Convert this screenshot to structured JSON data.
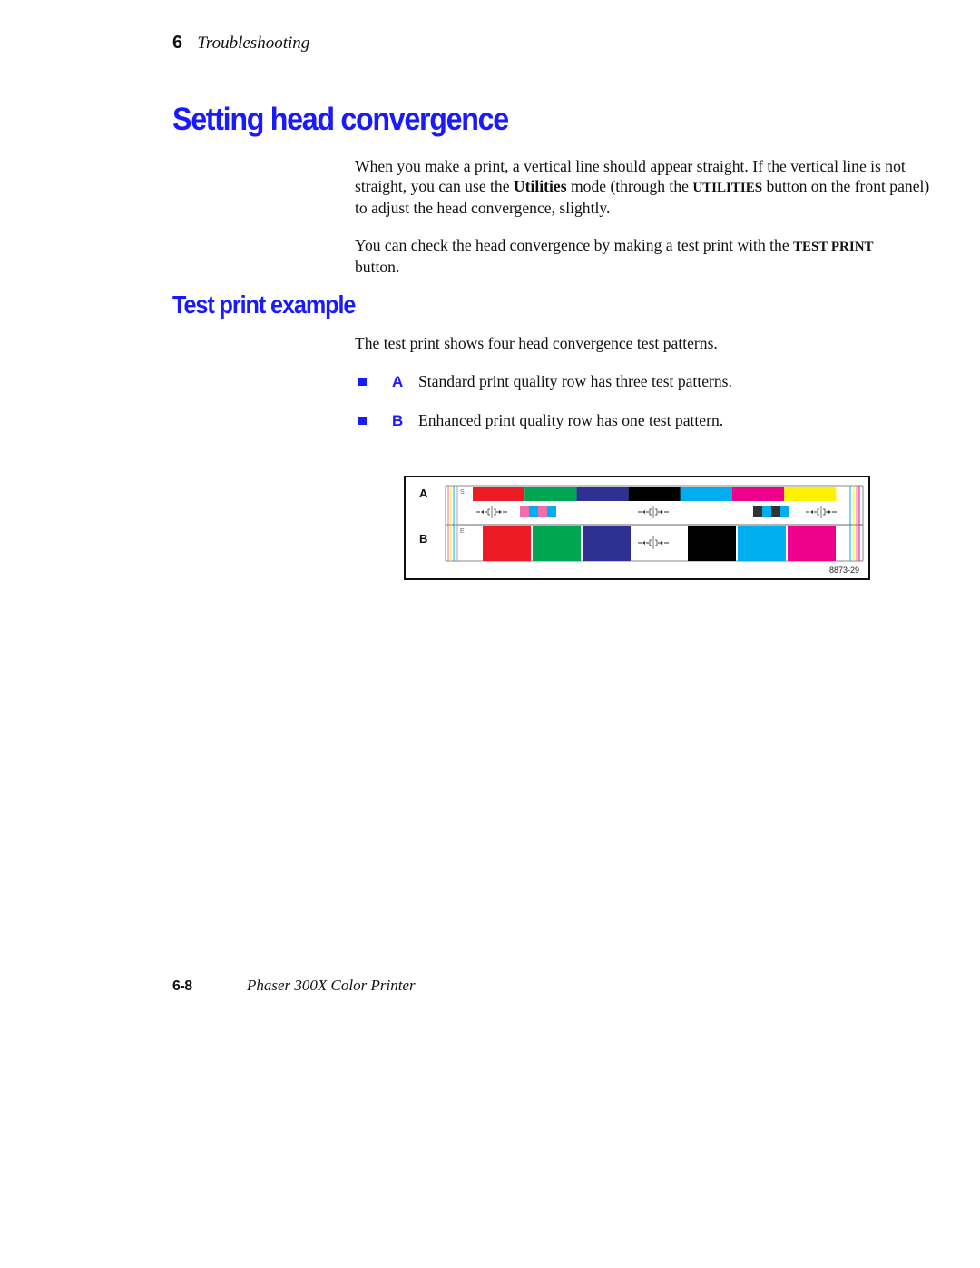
{
  "header": {
    "chapter_number": "6",
    "chapter_title": "Troubleshooting"
  },
  "section": {
    "title": "Setting head convergence",
    "paragraph1": {
      "part1": "When you make a print, a vertical line should appear straight.  If the vertical line is not straight, you can use the ",
      "bold1": "Utilities",
      "part2": " mode (through the ",
      "bold2": "UTILITIES",
      "part3": " button on the front panel) to adjust the head convergence, slightly."
    },
    "paragraph2": {
      "part1": "You can check the head convergence by making a test print with the ",
      "bold1": "TEST PRINT",
      "part2": " button."
    }
  },
  "subsection": {
    "title": "Test print example",
    "intro": "The test print shows four head convergence test patterns.",
    "bullets": [
      {
        "letter": "A",
        "text": "Standard print quality row has three test patterns."
      },
      {
        "letter": "B",
        "text": "Enhanced print quality row has one test pattern."
      }
    ]
  },
  "figure": {
    "row_labels": [
      "A",
      "B"
    ],
    "row_a_marker": "S",
    "row_b_marker": "E",
    "figure_id": "8873-29",
    "colors": {
      "red": "#ed1c24",
      "green": "#00a651",
      "blue": "#2e3192",
      "black": "#000000",
      "cyan": "#00aeef",
      "magenta": "#ec008c",
      "yellow": "#fff200",
      "pink": "#f06eaa",
      "darkgray": "#333333"
    },
    "row_a_bars": [
      "red",
      "green",
      "blue",
      "black",
      "cyan",
      "magenta",
      "yellow"
    ],
    "row_b_bars": [
      "red",
      "green",
      "blue",
      "pattern",
      "black",
      "cyan",
      "magenta"
    ]
  },
  "footer": {
    "page_number": "6-8",
    "book_title": "Phaser 300X Color Printer"
  }
}
